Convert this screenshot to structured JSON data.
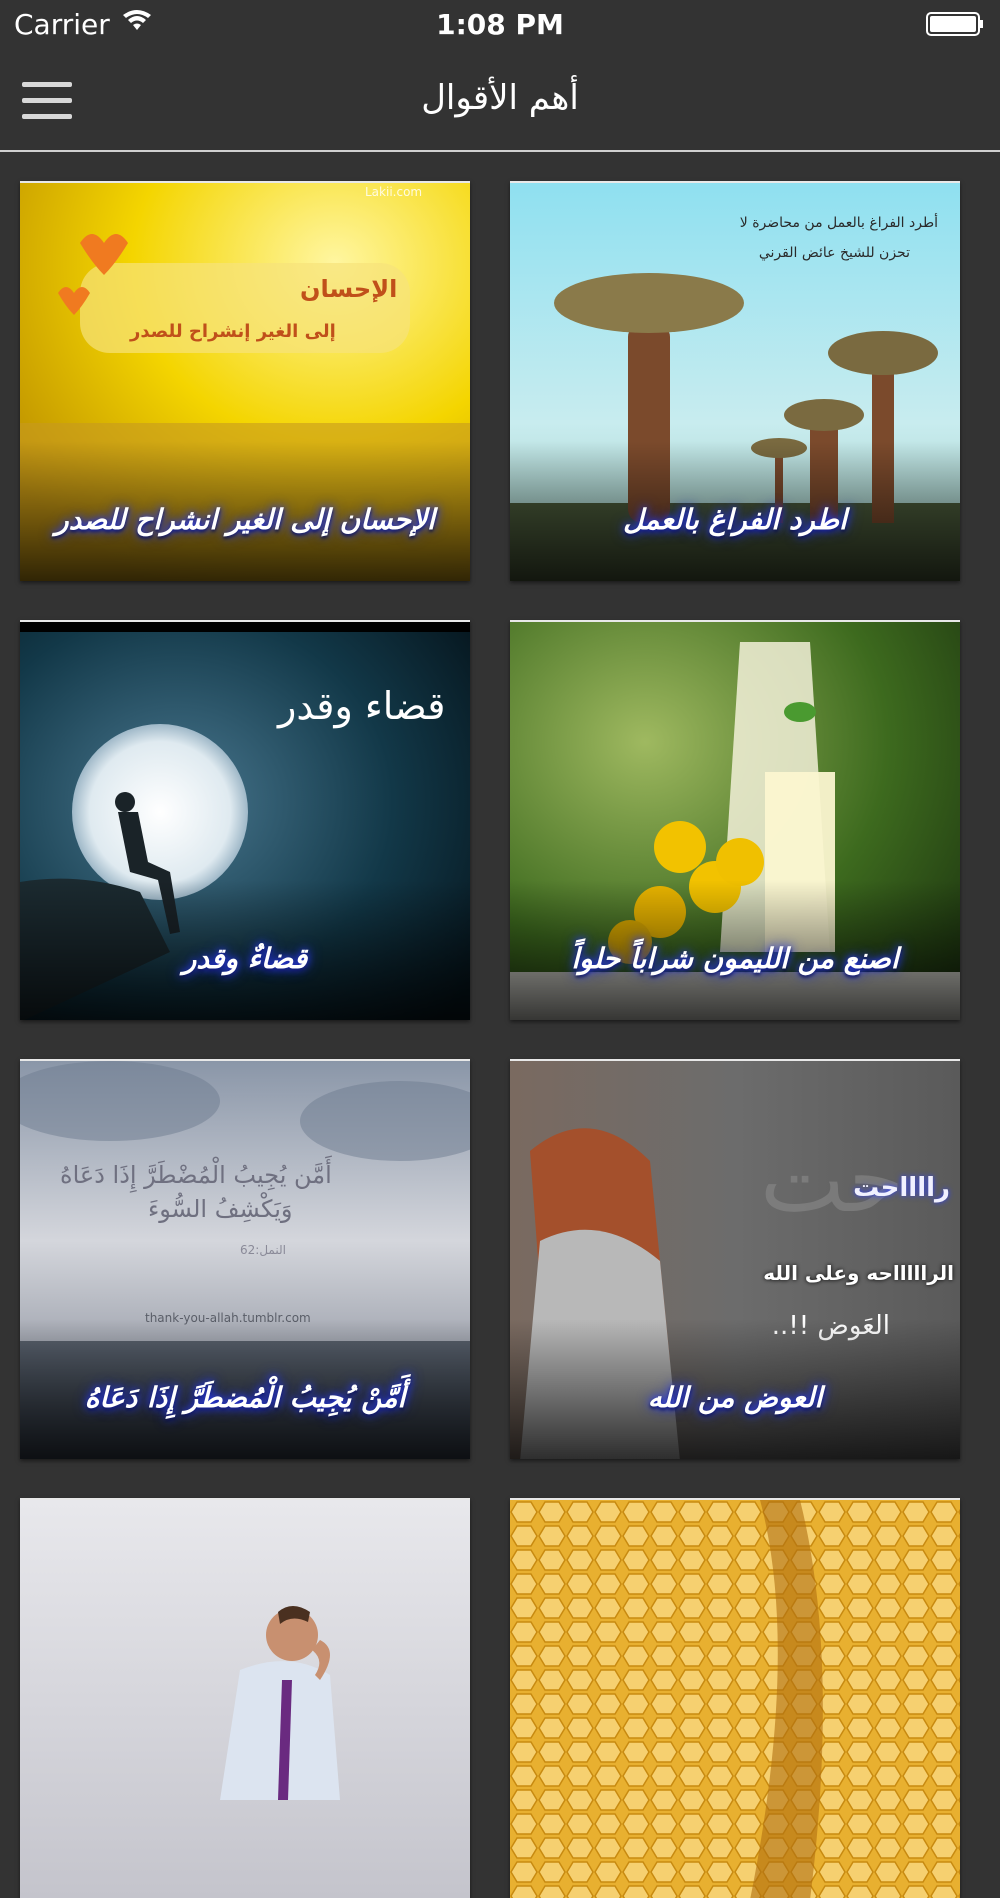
{
  "status_bar": {
    "carrier": "Carrier",
    "time": "1:08 PM"
  },
  "nav": {
    "title": "أهم الأقوال",
    "menu_icon": "hamburger-icon"
  },
  "cards": [
    {
      "caption": "اطرد الفراغ بالعمل",
      "image_text_1": "أطرد الفراغ بالعمل من محاضرة لا",
      "image_text_2": "تحزن للشيخ عائض القرني"
    },
    {
      "caption": "الإحسان إلى الغير انشراح للصدر",
      "image_text_1": "الإحسان",
      "image_text_2": "إلى الغير إنشراح للصدر",
      "watermark": "Lakii.com"
    },
    {
      "caption": "اصنع من الليمون شراباً حلواً"
    },
    {
      "caption": "قضاءٌ وقدر",
      "image_text_1": "قضاء وقدر"
    },
    {
      "caption": "العوض من الله",
      "image_text_1": "رااااحت",
      "image_text_2": "الراااااحه وعلى الله",
      "image_text_3": "العَوض !!.."
    },
    {
      "caption": "أَمَّنْ يُجِيبُ الْمُضطَرَّ إِذَا دَعَاهُ",
      "image_text_1": "أَمَّن يُجِيبُ الْمُضْطَرَّ إِذَا دَعَاهُ",
      "image_text_2": "وَيَكْشِفُ السُّوءَ",
      "image_text_3": "النمل:62",
      "watermark": "thank-you-allah.tumblr.com"
    },
    {
      "caption": ""
    },
    {
      "caption": ""
    }
  ],
  "colors": {
    "background": "#333333",
    "caption_glow": "#3040ff"
  }
}
